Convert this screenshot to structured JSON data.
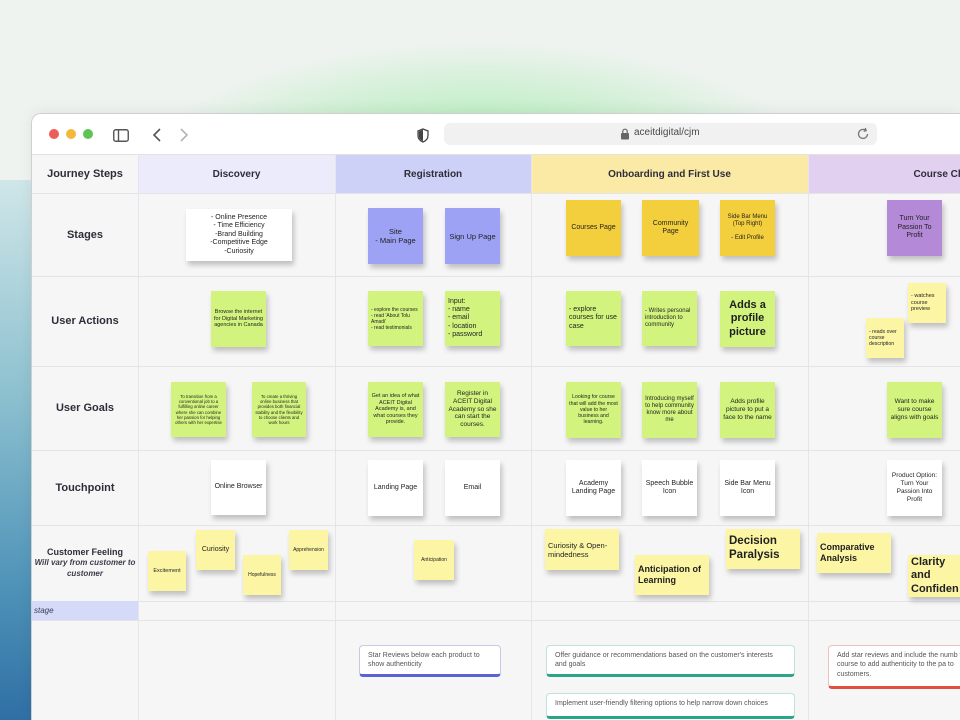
{
  "browser": {
    "url": "aceitdigital/cjm",
    "icons": [
      "close-dot",
      "minimize-dot",
      "zoom-dot",
      "sidebar-icon",
      "back-icon",
      "forward-icon",
      "shield-icon",
      "lock-icon",
      "reload-icon"
    ]
  },
  "rows": {
    "journey_steps": "Journey Steps",
    "stages": "Stages",
    "user_actions": "User Actions",
    "user_goals": "User Goals",
    "touchpoint": "Touchpoint",
    "customer_feeling": "Customer Feeling",
    "customer_feeling_sub": "Will vary from customer to customer",
    "stage": "stage"
  },
  "phases": {
    "discovery": "Discovery",
    "registration": "Registration",
    "onboarding": "Onboarding and First Use",
    "course": "Course Ch"
  },
  "colors": {
    "discovery": "#ebebfb",
    "registration": "#cdd0f7",
    "onboarding": "#faeaa6",
    "course": "#e1d0f0"
  },
  "stickies": {
    "disc_stage": "- Online Presence\n- Time Efficiency\n-Brand Building\n-Competitive Edge\n-Curiosity",
    "disc_action": "Browse the internet for Digital Marketing agencies in Canada",
    "disc_goal1": "To transition from a conventional job to a fulfilling online career where she can combine her passion for helping others with her expertise",
    "disc_goal2": "To create a thriving online business that provides both financial stability and the flexibility to choose clients and work hours",
    "disc_touch": "Online Browser",
    "feel_excitement": "Excitement",
    "feel_curiosity": "Curiosity",
    "feel_hopefulness": "Hopefulness",
    "feel_apprehension": "Apprehension",
    "reg_stage1": "Site\n- Main Page",
    "reg_stage2": "Sign Up Page",
    "reg_action1": "- explore the courses\n- read 'About Tolu Amadi'\n- read testimonials",
    "reg_action2": "Input:\n- name\n- email\n- location\n- password",
    "reg_goal1": "Get an idea of what ACEIT Digital Academy is, and what courses they provide.",
    "reg_goal2": "Register in ACEIT Digital Academy so she can start the courses.",
    "reg_touch1": "Landing Page",
    "reg_touch2": "Email",
    "feel_anticipation": "Anticipation",
    "onb_stage1": "Courses Page",
    "onb_stage2": "Community Page",
    "onb_stage3": "Side Bar Menu (Top Right)\n\n- Edit Profile",
    "onb_action1": "- explore courses for use case",
    "onb_action2": "- Writes personal introduction to community",
    "onb_action3": "Adds a profile picture",
    "onb_goal1": "Looking for course that will add the most value to her business and learning.",
    "onb_goal2": "Introducing myself to help community know more about me",
    "onb_goal3": "Adds profile picture to put a face to the name",
    "onb_touch1": "Academy Landing Page",
    "onb_touch2": "Speech Bubble Icon",
    "onb_touch3": "Side Bar Menu Icon",
    "feel_curiosity_open": "Curiosity & Open-mindedness",
    "feel_anticipation_learning": "Anticipation of Learning",
    "feel_decision": "Decision Paralysis",
    "course_stage": "Turn Your Passion To Profit",
    "course_action1": "- watches course preview",
    "course_action2": "- reads over course description",
    "course_goal": "Want to make sure course aligns with goals",
    "course_touch": "Product Option: Turn Your Passion Into Profit",
    "feel_comparative": "Comparative Analysis",
    "feel_clarity": "Clarity and Confiden"
  },
  "cards": {
    "reg_card": "Star Reviews below each product to show authenticity",
    "onb_card1": "Offer guidance or recommendations based on the customer's interests and goals",
    "onb_card2": "Implement user-friendly filtering options to help narrow down choices",
    "course_card": "Add star reviews and include the numb the course to add authenticity to the pa to customers."
  }
}
